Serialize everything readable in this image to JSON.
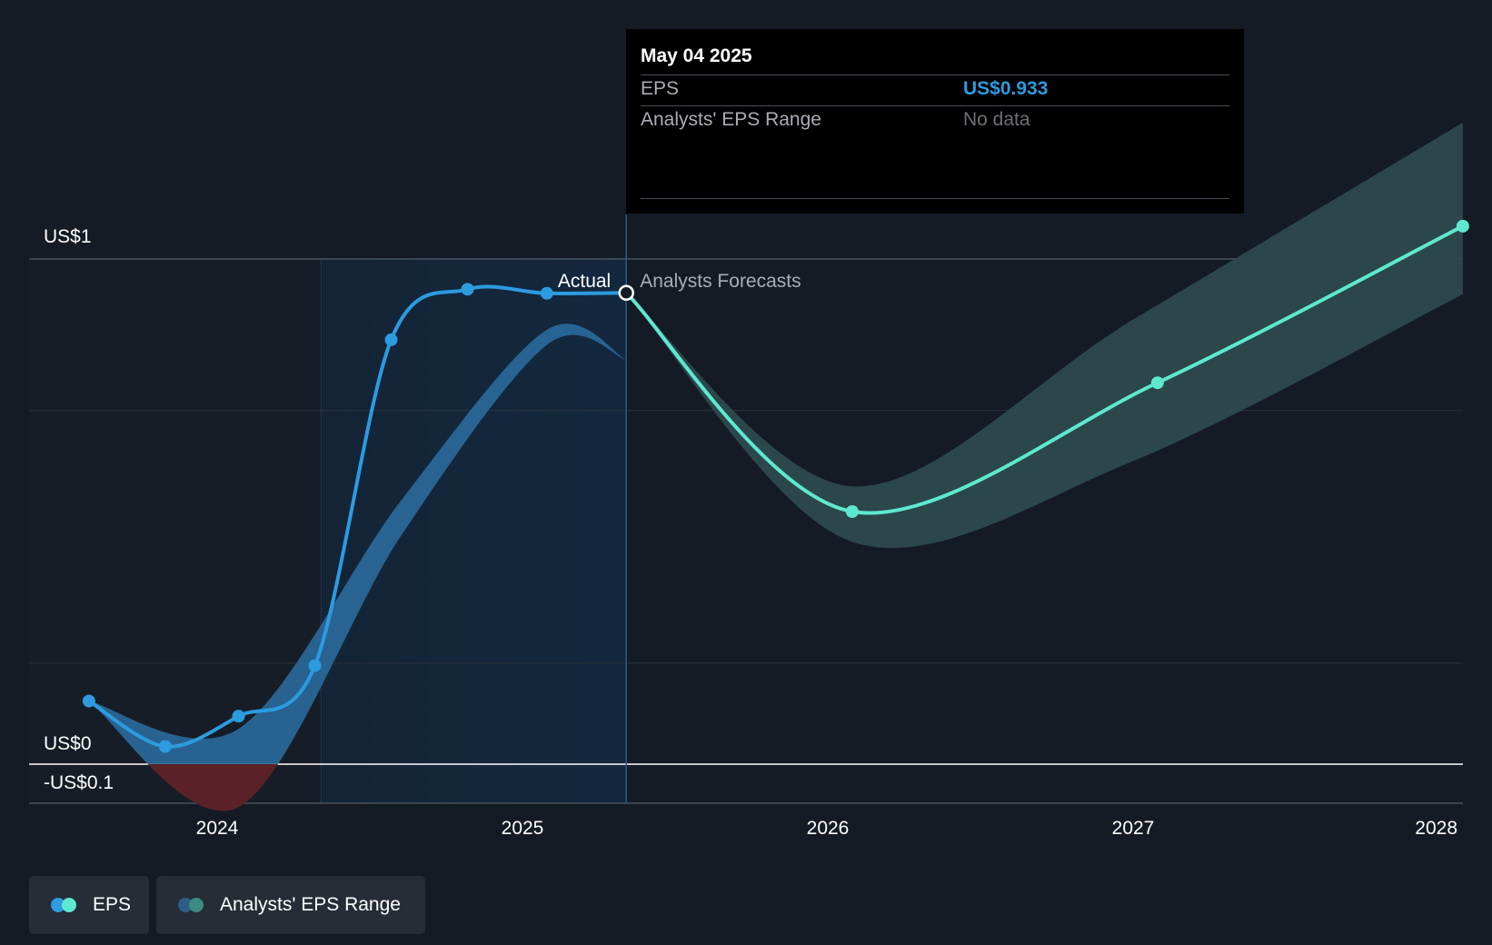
{
  "chart_data": {
    "type": "line",
    "y_axis": {
      "ylim": [
        -0.1,
        1.3
      ],
      "tick_labels": [
        "US$1",
        "US$0",
        "-US$0.1"
      ],
      "ticks": [
        1,
        0,
        -0.1
      ],
      "grid": true
    },
    "x_axis": {
      "tick_labels": [
        "2024",
        "2025",
        "2026",
        "2027",
        "2028"
      ],
      "ticks": [
        2024,
        2025,
        2026,
        2027,
        2028
      ]
    },
    "section_labels": {
      "actual": "Actual",
      "forecast": "Analysts Forecasts"
    },
    "series": [
      {
        "name": "EPS",
        "kind": "actual",
        "color": "#2c9be0",
        "points": [
          [
            2023.58,
            0.125
          ],
          [
            2023.83,
            0.035
          ],
          [
            2024.07,
            0.095
          ],
          [
            2024.32,
            0.195
          ],
          [
            2024.57,
            0.84
          ],
          [
            2024.82,
            0.94
          ],
          [
            2025.08,
            0.932
          ],
          [
            2025.34,
            0.933
          ]
        ]
      },
      {
        "name": "EPS",
        "kind": "forecast",
        "color": "#5ee8d0",
        "points": [
          [
            2025.34,
            0.933
          ],
          [
            2026.08,
            0.5
          ],
          [
            2027.08,
            0.755
          ],
          [
            2028.08,
            1.065
          ]
        ]
      }
    ],
    "ranges": [
      {
        "name": "Analysts' EPS Range",
        "kind": "actual",
        "upper": [
          [
            2023.58,
            0.125
          ],
          [
            2024.07,
            0.07
          ],
          [
            2024.6,
            0.52
          ],
          [
            2025.08,
            0.86
          ],
          [
            2025.34,
            0.8
          ]
        ],
        "lower": [
          [
            2023.58,
            0.125
          ],
          [
            2024.07,
            -0.085
          ],
          [
            2024.6,
            0.45
          ],
          [
            2025.08,
            0.83
          ],
          [
            2025.34,
            0.8
          ]
        ]
      },
      {
        "name": "Analysts' EPS Range",
        "kind": "forecast",
        "upper": [
          [
            2025.34,
            0.933
          ],
          [
            2026.08,
            0.55
          ],
          [
            2027.0,
            0.88
          ],
          [
            2028.08,
            1.27
          ]
        ],
        "lower": [
          [
            2025.34,
            0.933
          ],
          [
            2026.08,
            0.44
          ],
          [
            2027.0,
            0.6
          ],
          [
            2028.08,
            0.93
          ]
        ]
      }
    ],
    "highlight": {
      "x": 2025.34,
      "y": 0.933,
      "date": "May 04 2025"
    },
    "shaded_region": [
      2024.34,
      2025.34
    ]
  },
  "tooltip": {
    "date": "May 04 2025",
    "rows": [
      {
        "label": "EPS",
        "value": "US$0.933"
      },
      {
        "label": "Analysts' EPS Range",
        "value": "No data"
      }
    ]
  },
  "legend": {
    "items": [
      {
        "label": "EPS",
        "colors": [
          "#2c9be0",
          "#5ee8d0"
        ]
      },
      {
        "label": "Analysts' EPS Range",
        "colors": [
          "#2b5f86",
          "#3e8b84"
        ]
      }
    ]
  }
}
